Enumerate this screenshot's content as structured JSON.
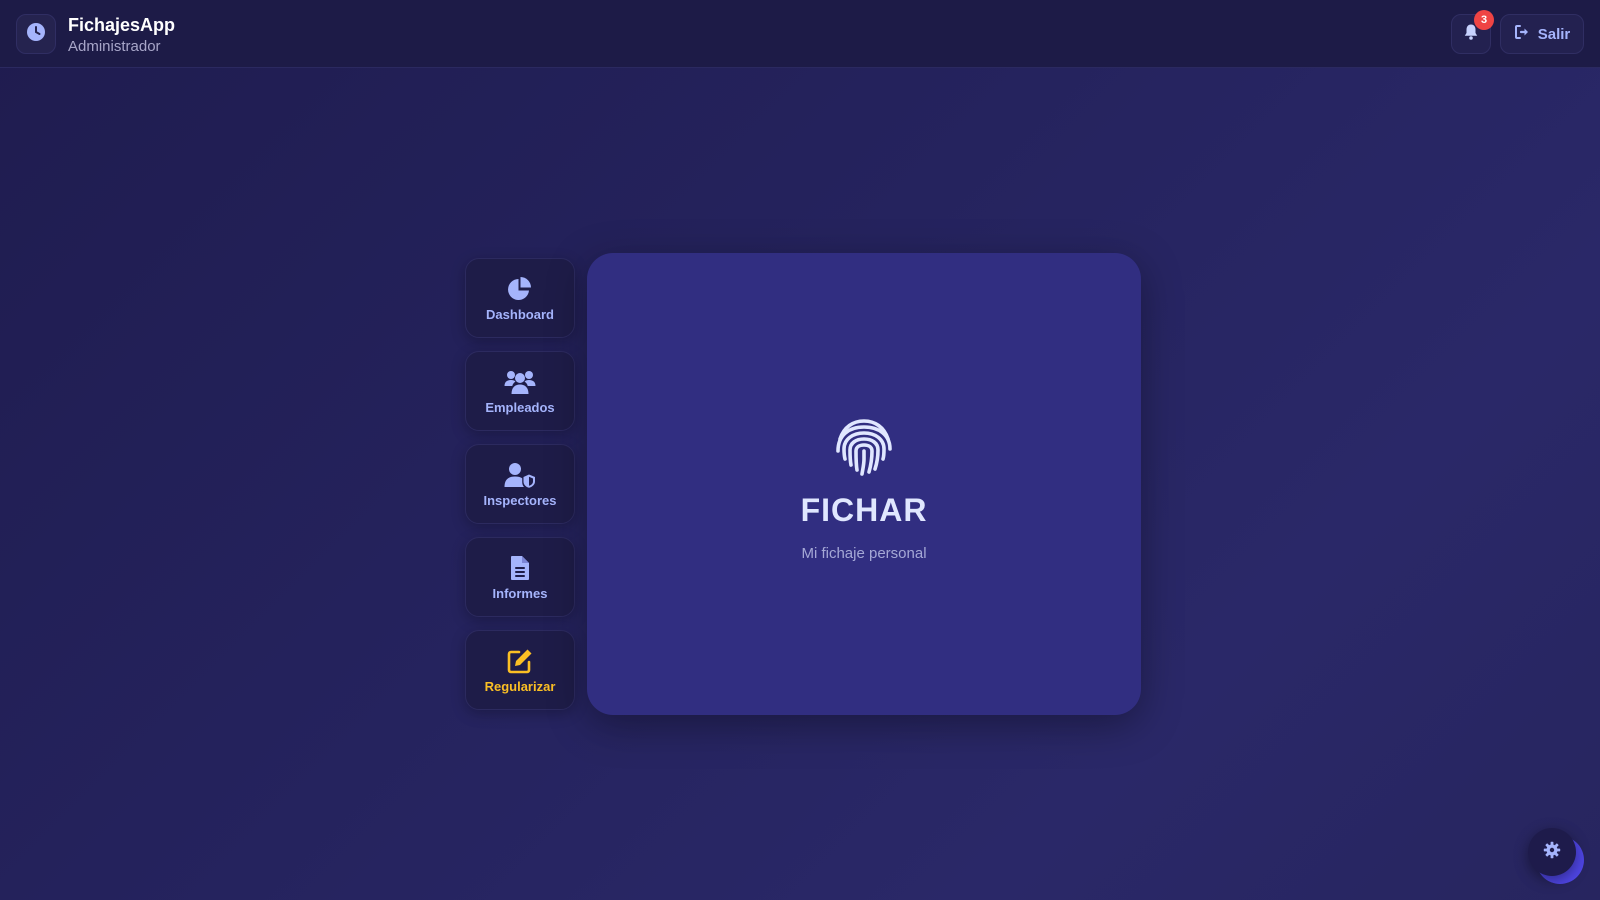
{
  "header": {
    "app_name": "FichajesApp",
    "role": "Administrador",
    "notifications_count": "3",
    "logout_label": "Salir",
    "icons": {
      "logo": "clock-icon",
      "bell": "bell-icon",
      "logout": "sign-out-icon"
    }
  },
  "sidebar": {
    "items": [
      {
        "label": "Dashboard",
        "icon": "pie-chart-icon"
      },
      {
        "label": "Empleados",
        "icon": "users-icon"
      },
      {
        "label": "Inspectores",
        "icon": "user-shield-icon"
      },
      {
        "label": "Informes",
        "icon": "file-alt-icon"
      },
      {
        "label": "Regularizar",
        "icon": "edit-icon"
      }
    ]
  },
  "main": {
    "title": "FICHAR",
    "subtitle": "Mi fichaje personal",
    "icon": "fingerprint-icon"
  },
  "settings_button": {
    "icon": "gear-icon"
  },
  "colors": {
    "accent": "#a5b4fc",
    "warning": "#fbbf24",
    "badge": "#ef4444",
    "card": "#312e81"
  }
}
